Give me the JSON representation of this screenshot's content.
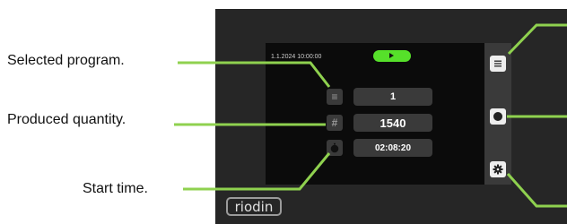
{
  "labels": {
    "selected_program": "Selected program.",
    "produced_quantity": "Produced quantity.",
    "start_time": "Start time."
  },
  "screen": {
    "timestamp": "1.1.2024 10:00:00",
    "status": "running",
    "program_value": "1",
    "quantity_value": "1540",
    "start_time_value": "02:08:20"
  },
  "icons": {
    "program": "list-icon",
    "quantity": "hash-icon",
    "time": "stopwatch-icon",
    "menu": "menu-icon",
    "stop": "stop-icon",
    "settings": "gear-icon"
  },
  "brand": {
    "logo_text": "riodin"
  },
  "colors": {
    "accent": "#8fd14f",
    "running": "#56e02a",
    "panel": "#3a3a3a"
  }
}
